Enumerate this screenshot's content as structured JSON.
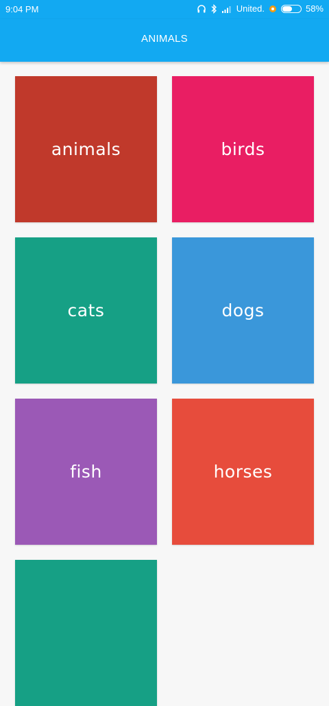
{
  "status_bar": {
    "time": "9:04 PM",
    "carrier": "United.",
    "battery_percent": "58%",
    "battery_level": 0.58,
    "icons": [
      "headphones-icon",
      "bluetooth-icon",
      "signal-icon",
      "notification-icon",
      "battery-icon"
    ]
  },
  "app_bar": {
    "title": "ANIMALS",
    "background": "#12a9f2"
  },
  "tiles": [
    {
      "label": "animals",
      "color": "#c0392b"
    },
    {
      "label": "birds",
      "color": "#e91e63"
    },
    {
      "label": "cats",
      "color": "#16a085"
    },
    {
      "label": "dogs",
      "color": "#3a97da"
    },
    {
      "label": "fish",
      "color": "#9b59b6"
    },
    {
      "label": "horses",
      "color": "#e74c3c"
    },
    {
      "label": "",
      "color": "#16a085"
    }
  ]
}
